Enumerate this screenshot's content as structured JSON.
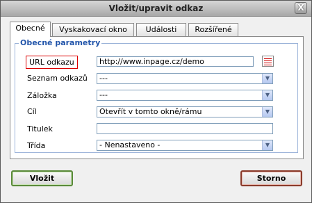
{
  "window": {
    "title": "Vložit/upravit odkaz",
    "close_label": "X"
  },
  "tabs": [
    {
      "label": "Obecné",
      "active": true
    },
    {
      "label": "Vyskakovací okno",
      "active": false
    },
    {
      "label": "Události",
      "active": false
    },
    {
      "label": "Rozšířené",
      "active": false
    }
  ],
  "fieldset": {
    "legend": "Obecné parametry"
  },
  "fields": {
    "url": {
      "label": "URL odkazu",
      "value": "http://www.inpage.cz/demo"
    },
    "link_list": {
      "label": "Seznam odkazů",
      "value": "---"
    },
    "anchor": {
      "label": "Záložka",
      "value": "---"
    },
    "target": {
      "label": "Cíl",
      "value": "Otevřít v tomto okně/rámu"
    },
    "title": {
      "label": "Titulek",
      "value": ""
    },
    "class": {
      "label": "Třída",
      "value": "- Nenastaveno -"
    }
  },
  "buttons": {
    "insert": "Vložit",
    "cancel": "Storno"
  },
  "colors": {
    "url_label_border": "#dd0000",
    "legend": "#2255aa"
  }
}
